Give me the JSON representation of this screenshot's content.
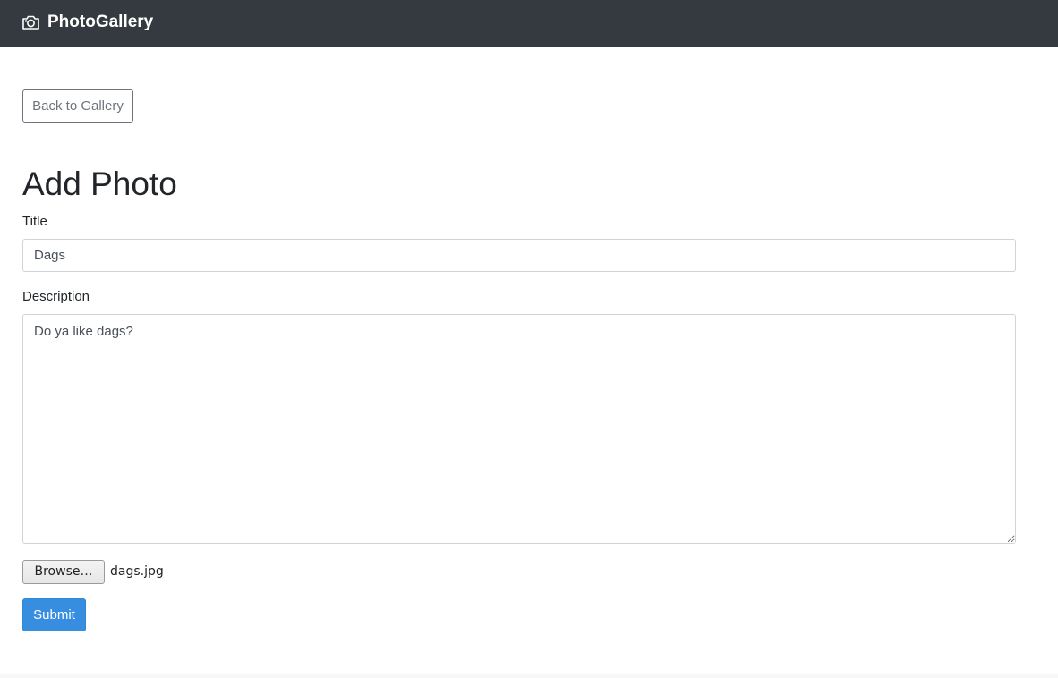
{
  "navbar": {
    "brand_icon": "camera-icon",
    "brand_text": "PhotoGallery",
    "background": "#343a40"
  },
  "back_button": {
    "label": "Back to Gallery"
  },
  "page": {
    "title": "Add Photo"
  },
  "form": {
    "title_label": "Title",
    "title_value": "Dags",
    "description_label": "Description",
    "description_value": "Do ya like dags?",
    "browse_label": "Browse…",
    "file_name": "dags.jpg",
    "submit_label": "Submit",
    "submit_color": "#378ee0"
  }
}
